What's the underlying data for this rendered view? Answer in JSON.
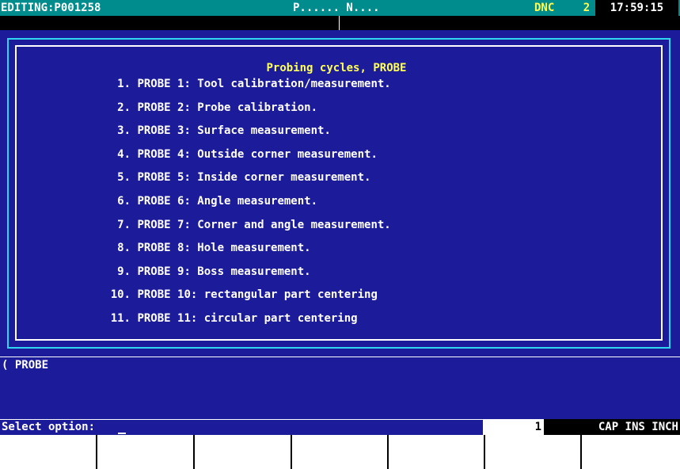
{
  "top_bar": {
    "editing": "EDITING:P001258",
    "program": "P...... N....",
    "mode": "DNC",
    "number": "2",
    "clock": "17:59:15"
  },
  "menu": {
    "title": "Probing cycles, PROBE",
    "items": [
      {
        "num": "1.",
        "label": "PROBE 1: Tool calibration/measurement."
      },
      {
        "num": "2.",
        "label": "PROBE 2: Probe calibration."
      },
      {
        "num": "3.",
        "label": "PROBE 3: Surface measurement."
      },
      {
        "num": "4.",
        "label": "PROBE 4: Outside corner measurement."
      },
      {
        "num": "5.",
        "label": "PROBE 5: Inside corner measurement."
      },
      {
        "num": "6.",
        "label": "PROBE 6: Angle measurement."
      },
      {
        "num": "7.",
        "label": "PROBE 7: Corner and angle measurement."
      },
      {
        "num": "8.",
        "label": "PROBE 8: Hole measurement."
      },
      {
        "num": "9.",
        "label": "PROBE 9: Boss measurement."
      },
      {
        "num": "10.",
        "label": "PROBE 10: rectangular part centering"
      },
      {
        "num": "11.",
        "label": "PROBE 11: circular part centering"
      }
    ]
  },
  "message": "( PROBE",
  "prompt": {
    "label": "Select option:",
    "value": ""
  },
  "counter": "1",
  "status": "CAP INS INCH",
  "softkeys": [
    "",
    "",
    "",
    "",
    "",
    "",
    ""
  ],
  "colors": {
    "background_blue": "#1c1c9a",
    "top_bar": "#008c8c",
    "frame_cyan": "#2ed6f0",
    "title_yellow": "#ffff55"
  }
}
